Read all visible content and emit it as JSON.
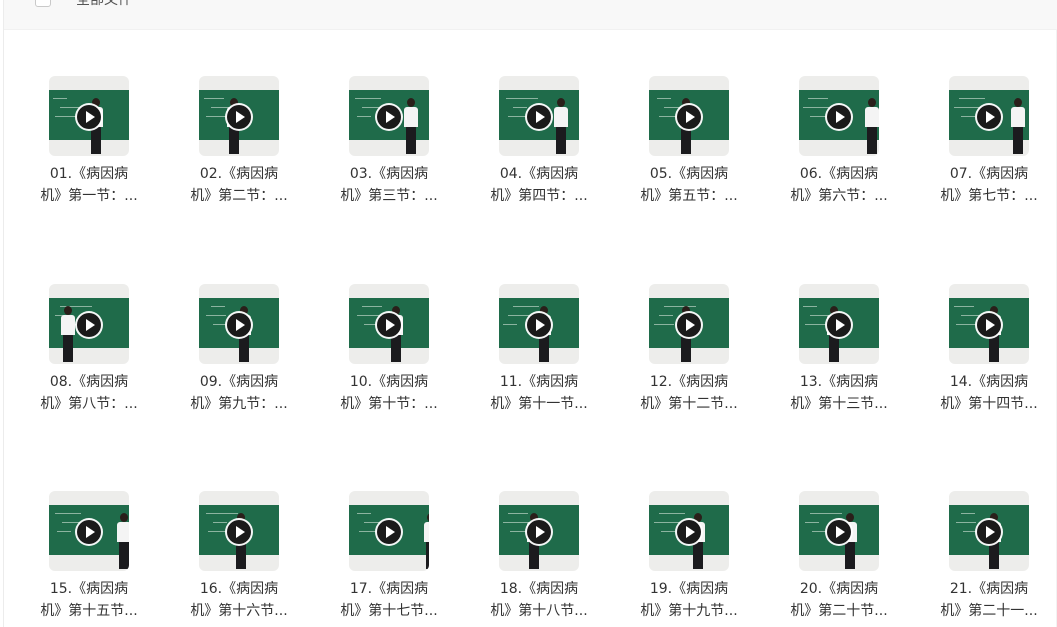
{
  "toolbar": {
    "select_all_label": "全部文件"
  },
  "files": [
    {
      "line1": "01.《病因病",
      "line2": "机》第一节：..."
    },
    {
      "line1": "02.《病因病",
      "line2": "机》第二节：..."
    },
    {
      "line1": "03.《病因病",
      "line2": "机》第三节：..."
    },
    {
      "line1": "04.《病因病",
      "line2": "机》第四节：..."
    },
    {
      "line1": "05.《病因病",
      "line2": "机》第五节：..."
    },
    {
      "line1": "06.《病因病",
      "line2": "机》第六节：..."
    },
    {
      "line1": "07.《病因病",
      "line2": "机》第七节：..."
    },
    {
      "line1": "08.《病因病",
      "line2": "机》第八节：..."
    },
    {
      "line1": "09.《病因病",
      "line2": "机》第九节：..."
    },
    {
      "line1": "10.《病因病",
      "line2": "机》第十节：..."
    },
    {
      "line1": "11.《病因病",
      "line2": "机》第十一节..."
    },
    {
      "line1": "12.《病因病",
      "line2": "机》第十二节..."
    },
    {
      "line1": "13.《病因病",
      "line2": "机》第十三节..."
    },
    {
      "line1": "14.《病因病",
      "line2": "机》第十四节..."
    },
    {
      "line1": "15.《病因病",
      "line2": "机》第十五节..."
    },
    {
      "line1": "16.《病因病",
      "line2": "机》第十六节..."
    },
    {
      "line1": "17.《病因病",
      "line2": "机》第十七节..."
    },
    {
      "line1": "18.《病因病",
      "line2": "机》第十八节..."
    },
    {
      "line1": "19.《病因病",
      "line2": "机》第十九节..."
    },
    {
      "line1": "20.《病因病",
      "line2": "机》第二十节..."
    },
    {
      "line1": "21.《病因病",
      "line2": "机》第二十一..."
    }
  ],
  "thumbnail_icon": "play-icon",
  "colors": {
    "chalkboard": "#1f6b4a",
    "text": "#333333",
    "toolbar_bg": "#f8f8f8"
  }
}
